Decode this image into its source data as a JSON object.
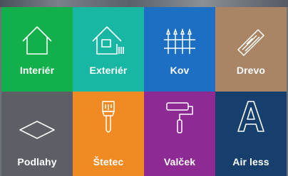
{
  "tiles": [
    {
      "label": "Interiér",
      "icon": "house-icon",
      "color": "#12b04a"
    },
    {
      "label": "Exteriér",
      "icon": "house-fence-icon",
      "color": "#17b7a3"
    },
    {
      "label": "Kov",
      "icon": "metal-fence-icon",
      "color": "#1c6fc2"
    },
    {
      "label": "Drevo",
      "icon": "wood-plank-icon",
      "color": "#a98566"
    },
    {
      "label": "Podlahy",
      "icon": "floor-icon",
      "color": "#5c5f66"
    },
    {
      "label": "Štetec",
      "icon": "paintbrush-icon",
      "color": "#f08a22"
    },
    {
      "label": "Valček",
      "icon": "paint-roller-icon",
      "color": "#8e2a93"
    },
    {
      "label": "Air less",
      "icon": "letter-a-icon",
      "color": "#163f6e"
    }
  ]
}
